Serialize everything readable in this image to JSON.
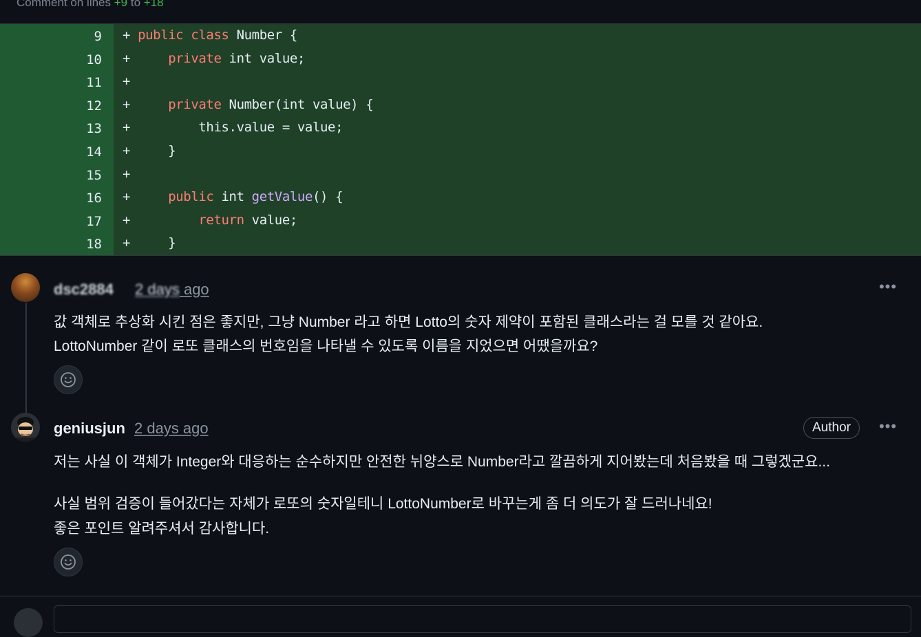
{
  "header": {
    "prefix": "Comment on lines",
    "from": "+9",
    "to_word": "to",
    "to": "+18"
  },
  "diff": [
    {
      "num": "9",
      "sign": "+",
      "parts": [
        [
          "kw",
          "public class "
        ],
        [
          "",
          "Number {"
        ]
      ]
    },
    {
      "num": "10",
      "sign": "+",
      "parts": [
        [
          "",
          "    "
        ],
        [
          "kw",
          "private "
        ],
        [
          "",
          "int value;"
        ]
      ]
    },
    {
      "num": "11",
      "sign": "+",
      "parts": []
    },
    {
      "num": "12",
      "sign": "+",
      "parts": [
        [
          "",
          "    "
        ],
        [
          "kw",
          "private "
        ],
        [
          "",
          "Number(int value) {"
        ]
      ]
    },
    {
      "num": "13",
      "sign": "+",
      "parts": [
        [
          "",
          "        this.value = value;"
        ]
      ]
    },
    {
      "num": "14",
      "sign": "+",
      "parts": [
        [
          "",
          "    }"
        ]
      ]
    },
    {
      "num": "15",
      "sign": "+",
      "parts": []
    },
    {
      "num": "16",
      "sign": "+",
      "parts": [
        [
          "",
          "    "
        ],
        [
          "kw",
          "public "
        ],
        [
          "",
          "int "
        ],
        [
          "fn",
          "getValue"
        ],
        [
          "",
          "() {"
        ]
      ]
    },
    {
      "num": "17",
      "sign": "+",
      "parts": [
        [
          "",
          "        "
        ],
        [
          "kw",
          "return "
        ],
        [
          "",
          "value;"
        ]
      ]
    },
    {
      "num": "18",
      "sign": "+",
      "parts": [
        [
          "",
          "    }"
        ]
      ]
    }
  ],
  "comments": [
    {
      "author": "dsc2884",
      "time_blurred": "2 days",
      "time": "ago",
      "lines": [
        "값 객체로 추상화 시킨 점은 좋지만, 그냥 Number 라고 하면 Lotto의 숫자 제약이 포함된 클래스라는 걸 모를 것 같아요.",
        "LottoNumber 같이 로또 클래스의 번호임을 나타낼 수 있도록 이름을 지었으면 어땠을까요?"
      ],
      "more_icon": "kebab-horizontal-icon",
      "reaction_icon": "smiley-icon"
    },
    {
      "author": "geniusjun",
      "time": "2 days ago",
      "badge": "Author",
      "lines": [
        "저는 사실 이 객체가 Integer와 대응하는 순수하지만 안전한 뉘양스로 Number라고 깔끔하게 지어봤는데 처음봤을 때 그렇겠군요...",
        "사실 범위 검증이 들어갔다는 자체가 로또의 숫자일테니 LottoNumber로 바꾸는게 좀 더 의도가 잘 드러나네요!",
        "좋은 포인트 알려주셔서 감사합니다."
      ],
      "more_icon": "kebab-horizontal-icon",
      "reaction_icon": "smiley-icon"
    }
  ],
  "colors": {
    "added_bg": "#1e4128",
    "added_gutter": "#1f5a32",
    "keyword": "#ff7b72",
    "function": "#d2a8ff"
  }
}
